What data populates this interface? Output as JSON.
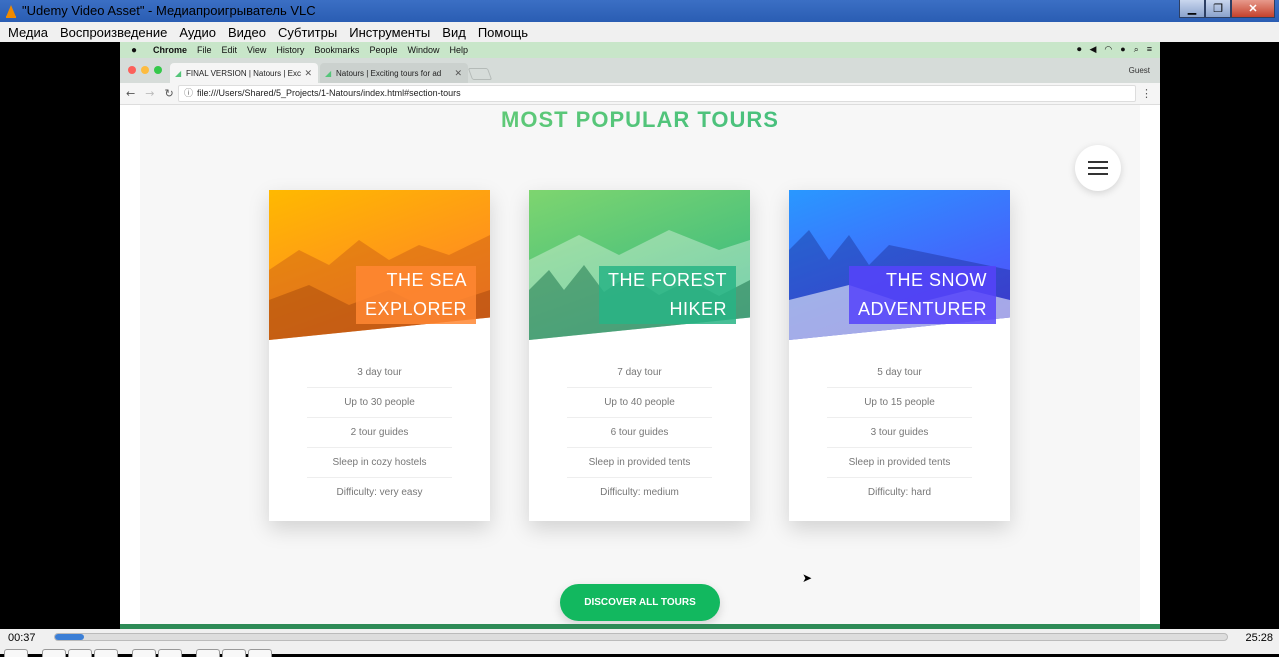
{
  "vlc": {
    "title": "\"Udemy Video Asset\" - Медиапроигрыватель VLC",
    "menu": [
      "Медиа",
      "Воспроизведение",
      "Аудио",
      "Видео",
      "Субтитры",
      "Инструменты",
      "Вид",
      "Помощь"
    ],
    "time_elapsed": "00:37",
    "time_total": "25:28",
    "progress": 0.025
  },
  "mac": {
    "apple": "",
    "menu": [
      "Chrome",
      "File",
      "Edit",
      "View",
      "History",
      "Bookmarks",
      "People",
      "Window",
      "Help"
    ]
  },
  "browser": {
    "tabs": [
      {
        "title": "FINAL VERSION | Natours | Exc",
        "active": true
      },
      {
        "title": "Natours | Exciting tours for ad",
        "active": false
      }
    ],
    "guest": "Guest",
    "url": "file:///Users/Shared/5_Projects/1-Natours/index.html#section-tours"
  },
  "page": {
    "section_title": "MOST POPULAR TOURS",
    "button": "DISCOVER ALL TOURS",
    "cards": [
      {
        "heading_line1": "THE SEA",
        "heading_line2": "EXPLORER",
        "theme": "sea",
        "details": [
          "3 day tour",
          "Up to 30 people",
          "2 tour guides",
          "Sleep in cozy hostels",
          "Difficulty: very easy"
        ]
      },
      {
        "heading_line1": "THE FOREST",
        "heading_line2": "HIKER",
        "theme": "forest",
        "details": [
          "7 day tour",
          "Up to 40 people",
          "6 tour guides",
          "Sleep in provided tents",
          "Difficulty: medium"
        ]
      },
      {
        "heading_line1": "THE SNOW",
        "heading_line2": "ADVENTURER",
        "theme": "snow",
        "details": [
          "5 day tour",
          "Up to 15 people",
          "3 tour guides",
          "Sleep in provided tents",
          "Difficulty: hard"
        ]
      }
    ]
  },
  "colors": {
    "green_light": "#7ed56f",
    "green_dark": "#28b485",
    "orange_light": "#ffb900",
    "orange_dark": "#ff7730",
    "blue_light": "#2998ff",
    "blue_dark": "#5643fa"
  }
}
